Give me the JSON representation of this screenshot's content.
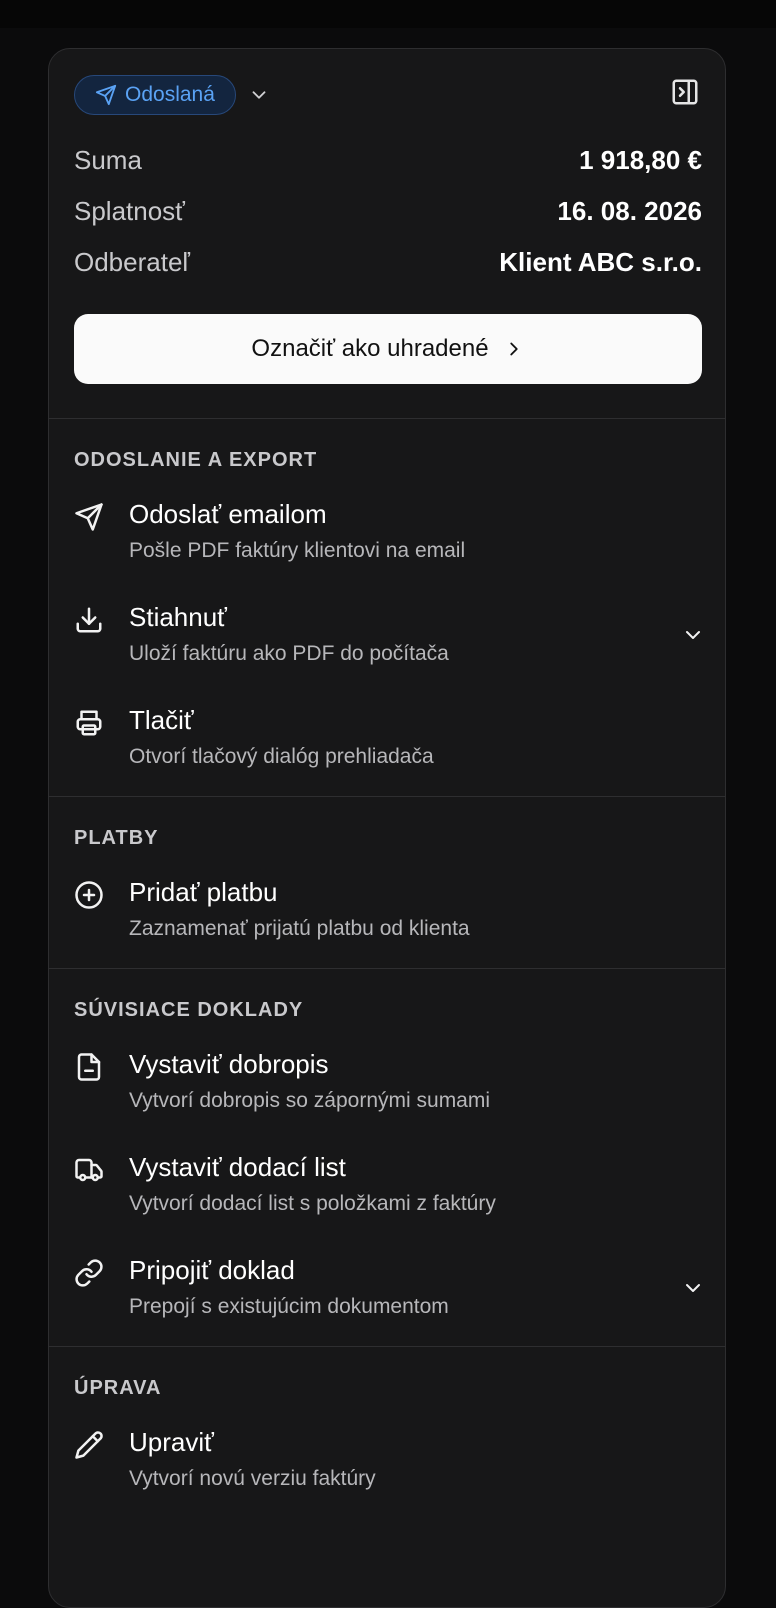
{
  "status": {
    "label": "Odoslaná",
    "icon": "send-icon",
    "color": "#5aa2f4"
  },
  "summary": [
    {
      "label": "Suma",
      "value": "1 918,80 €"
    },
    {
      "label": "Splatnosť",
      "value": "16. 08. 2026"
    },
    {
      "label": "Odberateľ",
      "value": "Klient ABC s.r.o."
    }
  ],
  "primary_action": {
    "label": "Označiť ako uhradené"
  },
  "sections": [
    {
      "title": "ODOSLANIE A EXPORT",
      "actions": [
        {
          "title": "Odoslať emailom",
          "subtitle": "Pošle PDF faktúry klientovi na email",
          "icon": "send-icon"
        },
        {
          "title": "Stiahnuť",
          "subtitle": "Uloží faktúru ako PDF do počítača",
          "icon": "download-icon",
          "expandable": true
        },
        {
          "title": "Tlačiť",
          "subtitle": "Otvorí tlačový dialóg prehliadača",
          "icon": "printer-icon"
        }
      ]
    },
    {
      "title": "PLATBY",
      "actions": [
        {
          "title": "Pridať platbu",
          "subtitle": "Zaznamenať prijatú platbu od klienta",
          "icon": "plus-circle-icon"
        }
      ]
    },
    {
      "title": "SÚVISIACE DOKLADY",
      "actions": [
        {
          "title": "Vystaviť dobropis",
          "subtitle": "Vytvorí dobropis so zápornými sumami",
          "icon": "file-minus-icon"
        },
        {
          "title": "Vystaviť dodací list",
          "subtitle": "Vytvorí dodací list s položkami z faktúry",
          "icon": "truck-icon"
        },
        {
          "title": "Pripojiť doklad",
          "subtitle": "Prepojí s existujúcim dokumentom",
          "icon": "link-icon",
          "expandable": true
        }
      ]
    },
    {
      "title": "ÚPRAVA",
      "actions": [
        {
          "title": "Upraviť",
          "subtitle": "Vytvorí novú verziu faktúry",
          "icon": "pencil-icon"
        }
      ]
    }
  ]
}
